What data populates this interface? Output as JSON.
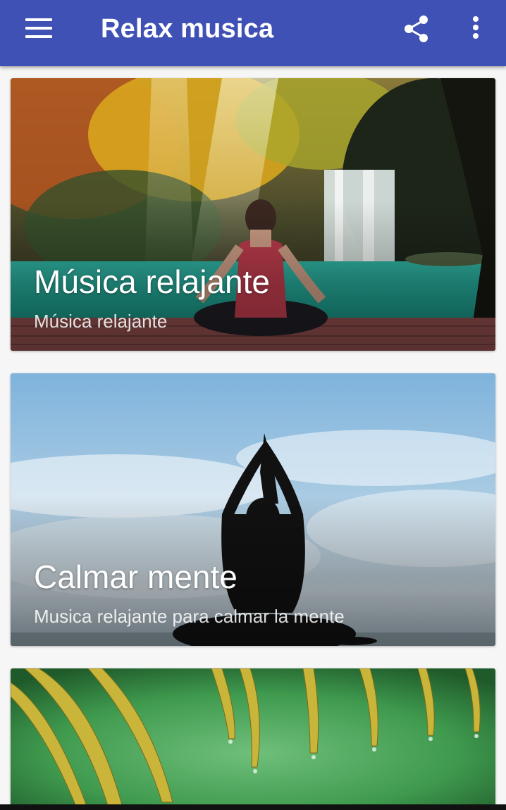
{
  "app": {
    "title": "Relax musica",
    "colors": {
      "appbar": "#3f51b5",
      "background": "#f6f6f6",
      "text_on_image": "#ffffff"
    },
    "toolbar_icons": [
      "menu-icon",
      "share-icon",
      "more-vert-icon"
    ]
  },
  "cards": [
    {
      "title": "Música relajante",
      "subtitle": "Música relajante",
      "image": "woman meditating in front of waterfall in autumn forest"
    },
    {
      "title": "Calmar mente",
      "subtitle": "Musica relajante para calmar la mente",
      "image": "silhouette of person in yoga pose against cloudy sky"
    },
    {
      "title": "",
      "subtitle": "",
      "image": "green bamboo leaves with water drops"
    }
  ]
}
